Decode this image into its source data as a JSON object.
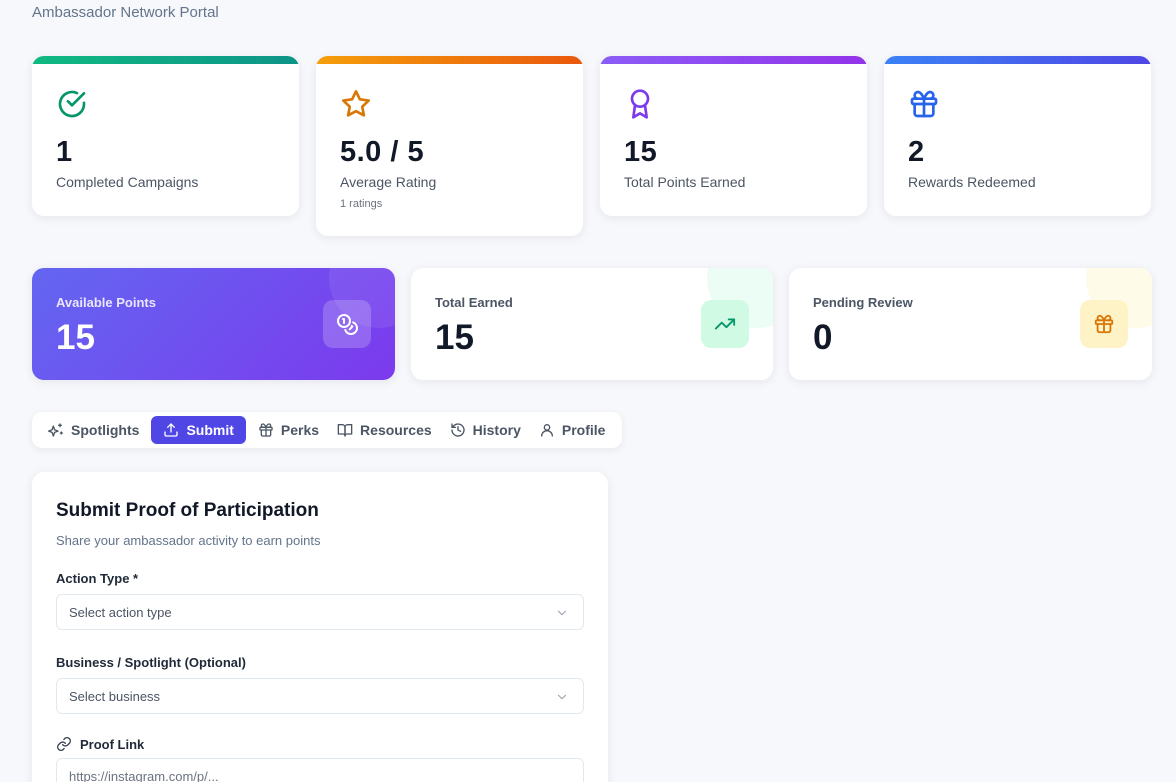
{
  "header": {
    "portal_title": "Ambassador Network Portal"
  },
  "stats": [
    {
      "value": "1",
      "label": "Completed Campaigns",
      "icon": "check-circle-icon",
      "accent": "#10b981"
    },
    {
      "value": "5.0 / 5",
      "label": "Average Rating",
      "sub": "1 ratings",
      "icon": "star-icon",
      "accent": "#f59e0b"
    },
    {
      "value": "15",
      "label": "Total Points Earned",
      "icon": "award-icon",
      "accent": "#7c3aed"
    },
    {
      "value": "2",
      "label": "Rewards Redeemed",
      "icon": "gift-icon",
      "accent": "#3b82f6"
    }
  ],
  "points": {
    "available": {
      "label": "Available Points",
      "value": "15",
      "icon": "coins-icon"
    },
    "total_earned": {
      "label": "Total Earned",
      "value": "15",
      "icon": "trending-up-icon"
    },
    "pending": {
      "label": "Pending Review",
      "value": "0",
      "icon": "gift-icon"
    }
  },
  "tabs": [
    {
      "label": "Spotlights",
      "icon": "sparkles-icon"
    },
    {
      "label": "Submit",
      "icon": "upload-icon",
      "active": true
    },
    {
      "label": "Perks",
      "icon": "gift-icon"
    },
    {
      "label": "Resources",
      "icon": "book-icon"
    },
    {
      "label": "History",
      "icon": "history-icon"
    },
    {
      "label": "Profile",
      "icon": "user-icon"
    }
  ],
  "form": {
    "title": "Submit Proof of Participation",
    "subtitle": "Share your ambassador activity to earn points",
    "action_type": {
      "label": "Action Type *",
      "placeholder": "Select action type"
    },
    "business": {
      "label": "Business / Spotlight (Optional)",
      "placeholder": "Select business"
    },
    "proof_link": {
      "label": "Proof Link",
      "placeholder": "https://instagram.com/p/..."
    }
  },
  "colors": {
    "primary": "#4f46e5",
    "green": "#10b981",
    "orange": "#f59e0b",
    "purple": "#7c3aed",
    "blue": "#3b82f6"
  }
}
